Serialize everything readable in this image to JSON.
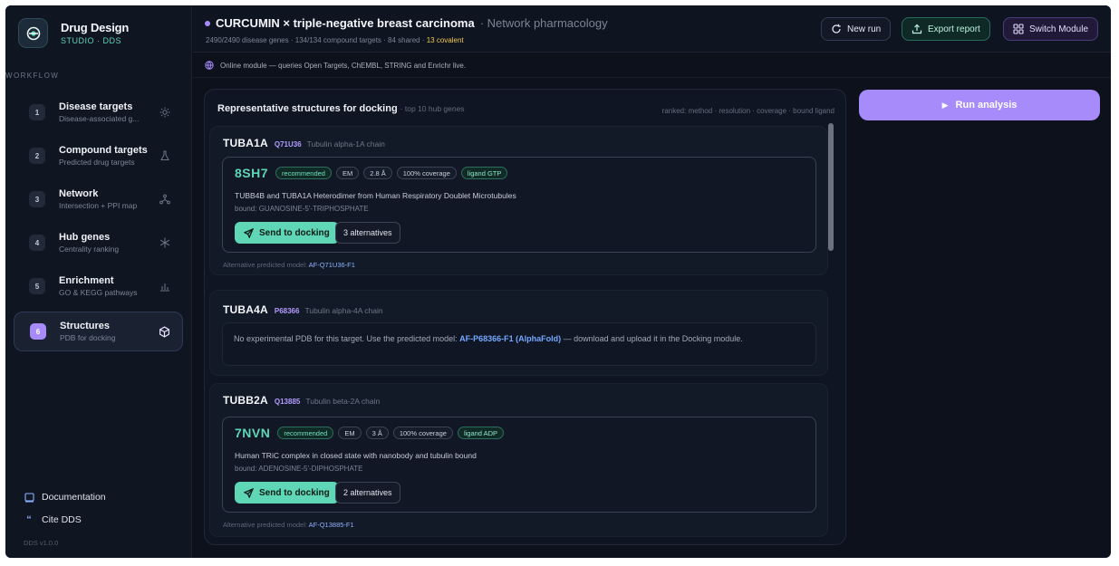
{
  "brand": {
    "name": "Drug Design",
    "subtitle": "STUDIO · DDS"
  },
  "sidebar": {
    "section_label": "WORKFLOW",
    "steps": [
      {
        "num": "1",
        "title": "Disease targets",
        "subtitle": "Disease-associated g...",
        "icon": "sun-icon"
      },
      {
        "num": "2",
        "title": "Compound targets",
        "subtitle": "Predicted drug targets",
        "icon": "flask-icon"
      },
      {
        "num": "3",
        "title": "Network",
        "subtitle": "Intersection + PPI map",
        "icon": "network-icon"
      },
      {
        "num": "4",
        "title": "Hub genes",
        "subtitle": "Centrality ranking",
        "icon": "snowflake-icon"
      },
      {
        "num": "5",
        "title": "Enrichment",
        "subtitle": "GO & KEGG pathways",
        "icon": "bar-chart-icon"
      },
      {
        "num": "6",
        "title": "Structures",
        "subtitle": "PDB for docking",
        "icon": "cube-icon",
        "active": true
      }
    ],
    "documentation": "Documentation",
    "cite": "Cite DDS",
    "version": "DDS v1.0.0"
  },
  "header": {
    "title": "CURCUMIN × triple-negative breast carcinoma",
    "tag": "· Network pharmacology",
    "stats_prefix": "2490/2490 disease genes · 134/134 compound targets · 84 shared · ",
    "stats_covalent": "13 covalent",
    "new_run": "New run",
    "export": "Export report",
    "switch": "Switch Module"
  },
  "info_strip": "Online module — queries Open Targets, ChEMBL, STRING and Enrichr live.",
  "card": {
    "title": "Representative structures for docking",
    "subtitle": "· top 10 hub genes",
    "ranked": "ranked: method · resolution · coverage · bound ligand",
    "genes": [
      {
        "symbol": "TUBA1A",
        "accession": "Q71U36",
        "name": "Tubulin alpha-1A chain",
        "pdb": {
          "id": "8SH7",
          "recommended": "recommended",
          "method": "EM",
          "resolution": "2.8 Å",
          "coverage": "100% coverage",
          "ligand": "ligand GTP",
          "description": "TUBB4B and TUBA1A Heterodimer from Human Respiratory Doublet Microtubules",
          "bound": "bound: GUANOSINE-5'-TRIPHOSPHATE",
          "dock_label": "Send to docking",
          "alternatives": "3 alternatives"
        },
        "alt_prefix": "Alternative predicted model: ",
        "alt_model": "AF-Q71U36-F1"
      },
      {
        "symbol": "TUBA4A",
        "accession": "P68366",
        "name": "Tubulin alpha-4A chain",
        "nopdb_prefix": "No experimental PDB for this target. Use the predicted model: ",
        "nopdb_link": "AF-P68366-F1 (AlphaFold)",
        "nopdb_suffix": " — download and upload it in the Docking module."
      },
      {
        "symbol": "TUBB2A",
        "accession": "Q13885",
        "name": "Tubulin beta-2A chain",
        "pdb": {
          "id": "7NVN",
          "recommended": "recommended",
          "method": "EM",
          "resolution": "3 Å",
          "coverage": "100% coverage",
          "ligand": "ligand ADP",
          "description": "Human TRiC complex in closed state with nanobody and tubulin bound",
          "bound": "bound: ADENOSINE-5'-DIPHOSPHATE",
          "dock_label": "Send to docking",
          "alternatives": "2 alternatives"
        },
        "alt_prefix": "Alternative predicted model: ",
        "alt_model": "AF-Q13885-F1"
      }
    ]
  },
  "run_button": "Run analysis",
  "colors": {
    "accent": "#a78bfa",
    "teal": "#5fd6b5",
    "background": "#0c111c",
    "warning": "#f2c94c"
  }
}
